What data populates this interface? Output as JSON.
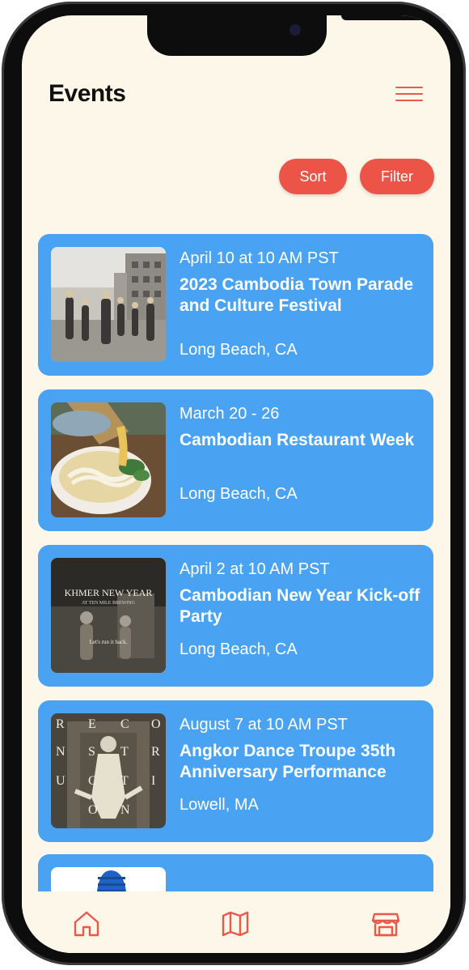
{
  "header": {
    "title": "Events"
  },
  "controls": {
    "sort_label": "Sort",
    "filter_label": "Filter"
  },
  "events": [
    {
      "date": "April 10 at 10 AM PST",
      "title": "2023 Cambodia Town Parade and Culture Festival",
      "location": "Long Beach, CA",
      "image": "parade-photo"
    },
    {
      "date": "March 20 - 26",
      "title": "Cambodian Restaurant Week",
      "location": "Long Beach, CA",
      "image": "noodle-soup-photo"
    },
    {
      "date": "April 2 at 10 AM PST",
      "title": "Cambodian New Year Kick-off Party",
      "location": "Long Beach, CA",
      "image": "khmer-new-year-poster",
      "poster_text": [
        "KHMER NEW YEAR",
        "AT TEN MILE BREWING",
        "Let's run it back."
      ]
    },
    {
      "date": "August 7 at 10 AM PST",
      "title": "Angkor Dance Troupe 35th Anniversary Performance",
      "location": "Lowell, MA",
      "image": "reconstruction-poster",
      "poster_letters": [
        "R",
        "E",
        "C",
        "O",
        "N",
        "S",
        "T",
        "R",
        "U",
        "C",
        "T",
        "I",
        "O",
        "N"
      ]
    }
  ],
  "tabbar": {
    "icons": [
      "home-icon",
      "map-icon",
      "store-icon"
    ]
  },
  "colors": {
    "background": "#fcf7e9",
    "card": "#4aa3f2",
    "accent": "#ec5447",
    "menu": "#e8594b"
  }
}
